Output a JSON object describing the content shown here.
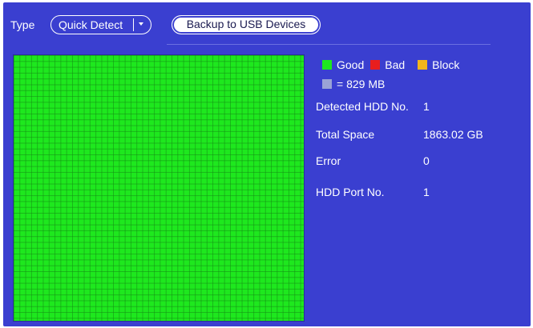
{
  "header": {
    "type_label": "Type",
    "type_value": "Quick Detect",
    "backup_button": "Backup to USB Devices"
  },
  "legend": {
    "good": {
      "label": "Good",
      "color": "#1ee81e"
    },
    "bad": {
      "label": "Bad",
      "color": "#e81e1e"
    },
    "block": {
      "label": "Block",
      "color": "#f2b51c"
    },
    "unit": {
      "label": "= 829 MB",
      "color": "#9aa3d6"
    }
  },
  "info": {
    "detected_hdd_label": "Detected HDD No.",
    "detected_hdd_value": "1",
    "total_space_label": "Total Space",
    "total_space_value": "1863.02 GB",
    "error_label": "Error",
    "error_value": "0",
    "hdd_port_label": "HDD Port No.",
    "hdd_port_value": "1"
  },
  "colors": {
    "panel_bg": "#3a3fd0",
    "map_good": "#1ee81e"
  }
}
